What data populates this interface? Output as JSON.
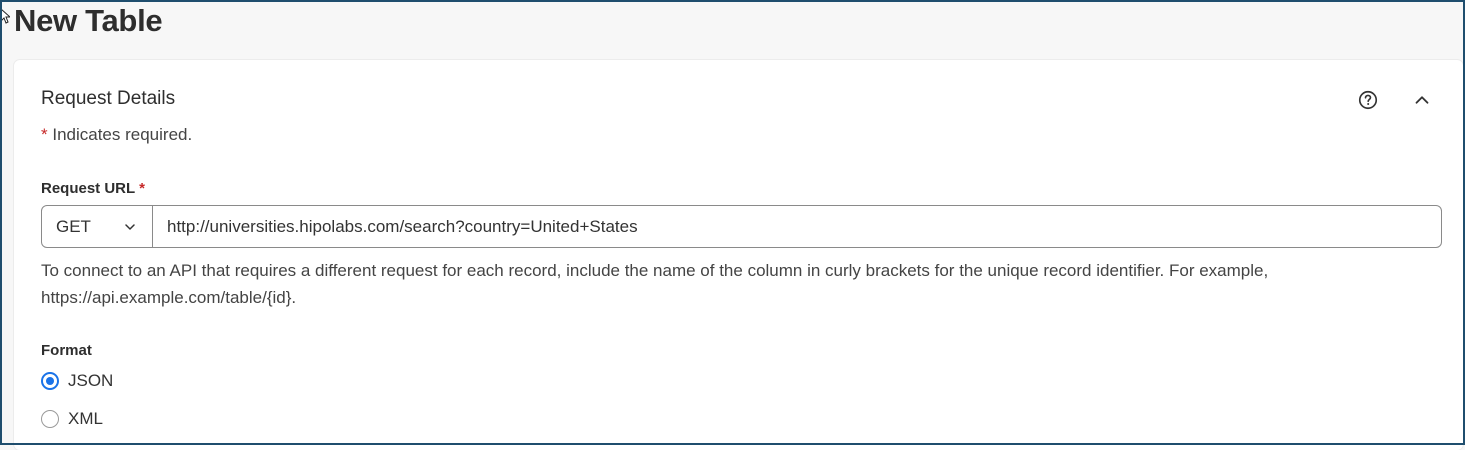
{
  "page": {
    "title": "New Table"
  },
  "section": {
    "title": "Request Details",
    "required_star": "*",
    "required_note": " Indicates required.",
    "help_icon": "help-circle-icon",
    "collapse_icon": "chevron-up-icon"
  },
  "request_url": {
    "label": "Request URL",
    "required_star": "*",
    "method": "GET",
    "method_icon": "chevron-down-icon",
    "value": "http://universities.hipolabs.com/search?country=United+States",
    "hint": "To connect to an API that requires a different request for each record, include the name of the column in curly brackets for the unique record identifier. For example, https://api.example.com/table/{id}."
  },
  "format": {
    "label": "Format",
    "options": [
      {
        "label": "JSON",
        "selected": true
      },
      {
        "label": "XML",
        "selected": false
      }
    ]
  },
  "colors": {
    "accent": "#1a73e8",
    "required": "#c62828",
    "frame_border": "#1f4e6e"
  }
}
